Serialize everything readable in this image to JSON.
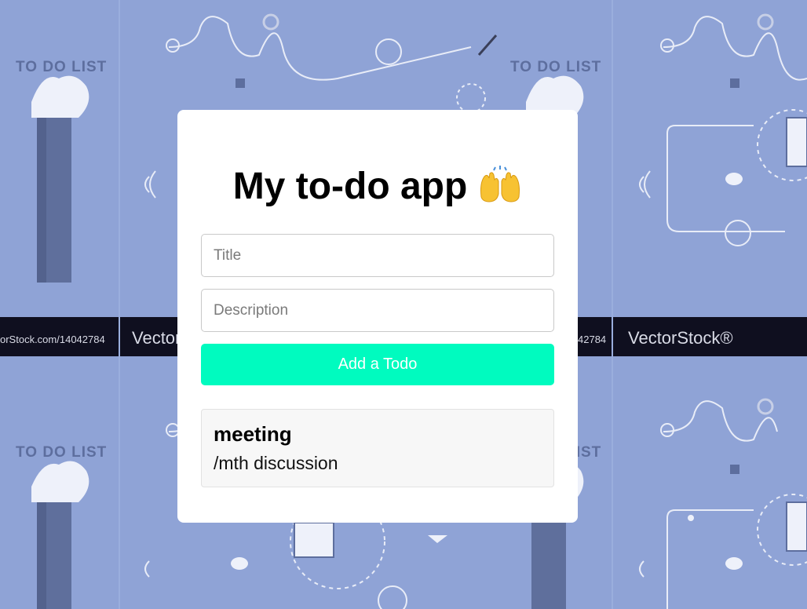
{
  "background": {
    "color": "#8fa3d6",
    "labels": [
      "TO DO LIST",
      "TO DO LIST",
      "TO DO LIST",
      "TO DO LIST"
    ],
    "watermark_url": "orStock.com/14042784",
    "watermark_url_right": "42784",
    "watermark_brand_left": "Vector",
    "watermark_brand_right": "VectorStock®"
  },
  "app": {
    "title": "My to-do app",
    "title_emoji": "raising-hands-icon"
  },
  "form": {
    "title_placeholder": "Title",
    "title_value": "",
    "description_placeholder": "Description",
    "description_value": "",
    "submit_label": "Add a Todo",
    "submit_color": "#00fbbf"
  },
  "todos": [
    {
      "title": "meeting",
      "description": "/mth discussion"
    }
  ]
}
